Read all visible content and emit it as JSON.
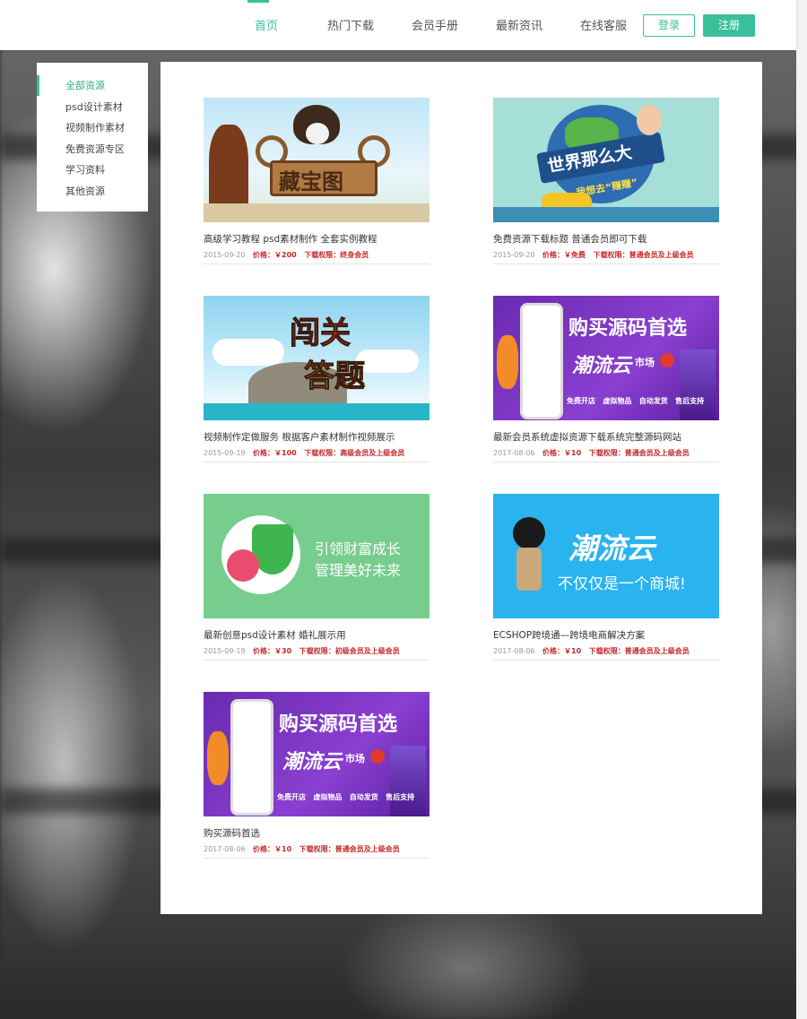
{
  "header": {
    "nav": [
      "首页",
      "热门下载",
      "会员手册",
      "最新资讯",
      "在线客服"
    ],
    "login": "登录",
    "register": "注册"
  },
  "sidebar": {
    "items": [
      "全部资源",
      "psd设计素材",
      "视频制作素材",
      "免费资源专区",
      "学习资料",
      "其他资源"
    ]
  },
  "cards": [
    {
      "title": "高级学习教程 psd素材制作 全套实例教程",
      "date": "2015-09-20",
      "price": "价格：￥200",
      "perm": "下载权限：终身会员",
      "image_text": "藏宝图"
    },
    {
      "title": "免费资源下载标题 普通会员即可下载",
      "date": "2015-09-20",
      "price": "价格：￥免费",
      "perm": "下载权限：普通会员及上级会员",
      "image_text": "世界那么大",
      "image_subtext": "我想去“赚赚”"
    },
    {
      "title": "视频制作定做服务 根据客户素材制作视频展示",
      "date": "2015-09-19",
      "price": "价格：￥100",
      "perm": "下载权限：高级会员及上级会员",
      "image_text": "闯关",
      "image_subtext": "答题"
    },
    {
      "title": "最新会员系统虚拟资源下载系统完整源码网站",
      "date": "2017-08-06",
      "price": "价格：￥10",
      "perm": "下载权限：普通会员及上级会员",
      "image_text": "购买源码首选",
      "image_subtext": "潮流云",
      "image_badge": "市场",
      "image_tags": [
        "免费开店",
        "虚拟物品",
        "自动发货",
        "售后支持"
      ]
    },
    {
      "title": "最新创意psd设计素材 婚礼展示用",
      "date": "2015-09-19",
      "price": "价格：￥30",
      "perm": "下载权限：初级会员及上级会员",
      "image_text": "引领财富成长",
      "image_subtext": "管理美好未来"
    },
    {
      "title": "ECSHOP跨境通—跨境电商解决方案",
      "date": "2017-08-06",
      "price": "价格：￥10",
      "perm": "下载权限：普通会员及上级会员",
      "image_text": "潮流云",
      "image_subtext": "不仅仅是一个商城!"
    },
    {
      "title": "购买源码首选",
      "date": "2017-08-06",
      "price": "价格：￥10",
      "perm": "下载权限：普通会员及上级会员",
      "image_text": "购买源码首选",
      "image_subtext": "潮流云",
      "image_badge": "市场",
      "image_tags": [
        "免费开店",
        "虚拟物品",
        "自动发货",
        "售后支持"
      ]
    }
  ],
  "colors": {
    "accent": "#3bbf9a",
    "price": "#c62828"
  }
}
